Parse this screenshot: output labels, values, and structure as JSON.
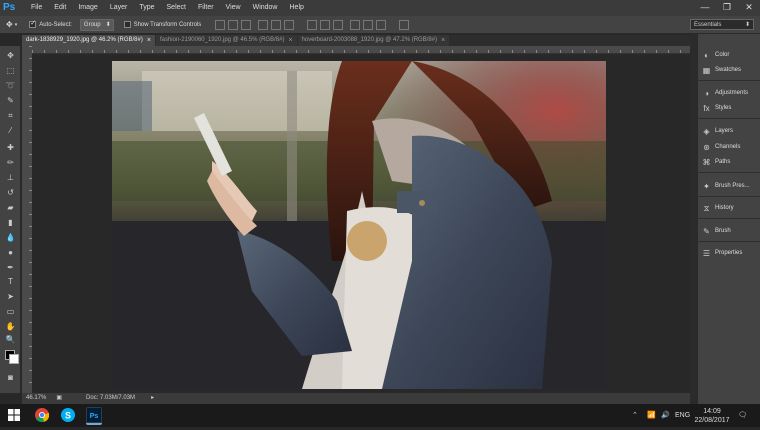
{
  "app": {
    "logo_text": "Ps"
  },
  "menu": [
    "File",
    "Edit",
    "Image",
    "Layer",
    "Type",
    "Select",
    "Filter",
    "View",
    "Window",
    "Help"
  ],
  "window_controls": {
    "minimize": "—",
    "restore": "❐",
    "close": "✕"
  },
  "options": {
    "auto_select_label": "Auto-Select:",
    "auto_select_value": "Group",
    "show_transform_label": "Show Transform Controls",
    "workspace": "Essentials"
  },
  "tabs": [
    {
      "label": "dark-1838929_1920.jpg @ 46.2% (RGB/8#)",
      "active": true
    },
    {
      "label": "fashion-2190060_1920.jpg @ 46.5% (RGB/8#)",
      "active": false
    },
    {
      "label": "hoverboard-2003088_1920.jpg @ 47.2% (RGB/8#)",
      "active": false
    }
  ],
  "status": {
    "zoom": "46.17%",
    "doc": "Doc: 7.03M/7.03M"
  },
  "panels": [
    {
      "label": "Color",
      "icon": "color-wheel-icon"
    },
    {
      "label": "Swatches",
      "icon": "swatches-icon"
    },
    {
      "label": "Adjustments",
      "icon": "adjustments-icon"
    },
    {
      "label": "Styles",
      "icon": "styles-icon"
    },
    {
      "label": "Layers",
      "icon": "layers-icon"
    },
    {
      "label": "Channels",
      "icon": "channels-icon"
    },
    {
      "label": "Paths",
      "icon": "paths-icon"
    },
    {
      "label": "Brush Pres...",
      "icon": "brush-presets-icon"
    },
    {
      "label": "History",
      "icon": "history-icon"
    },
    {
      "label": "Brush",
      "icon": "brush-icon"
    },
    {
      "label": "Properties",
      "icon": "properties-icon"
    }
  ],
  "taskbar": {
    "language": "ENG",
    "time": "14:09",
    "date": "22/08/2017"
  },
  "colors": {
    "accent": "#31a8ff",
    "ui_dark": "#282828",
    "panel": "#434343"
  }
}
